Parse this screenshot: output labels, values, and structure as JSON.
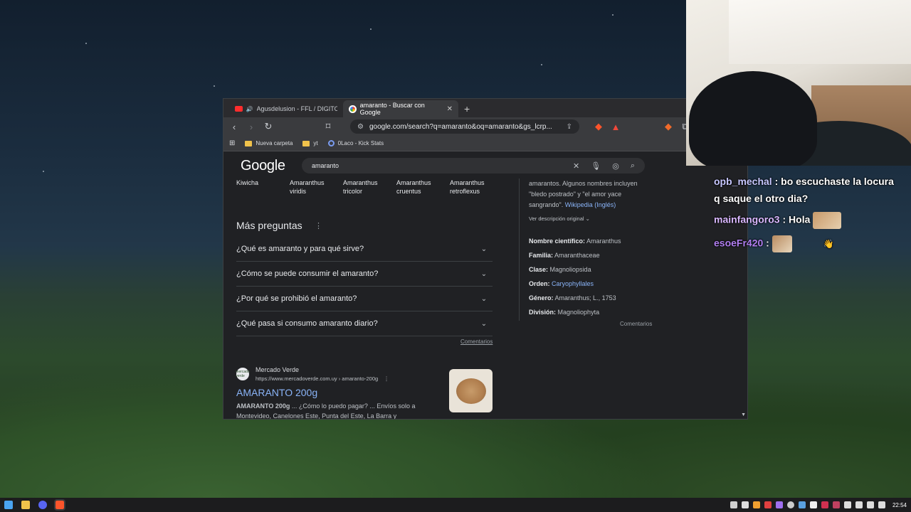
{
  "browser": {
    "tabs": [
      {
        "label": "Agusdelusion - FFL / DIGITOS | C",
        "active": false
      },
      {
        "label": "amaranto - Buscar con Google",
        "active": true
      }
    ],
    "url": "google.com/search?q=amaranto&oq=amaranto&gs_lcrp...",
    "bookmarks": [
      "Nueva carpeta",
      "yt",
      "0Laco - Kick Stats"
    ]
  },
  "google": {
    "logo": "Google",
    "query": "amaranto",
    "related": [
      "Kiwicha",
      "Amaranthus viridis",
      "Amaranthus tricolor",
      "Amaranthus cruentus",
      "Amaranthus retroflexus"
    ],
    "more_questions": {
      "title": "Más preguntas",
      "items": [
        "¿Qué es amaranto y para qué sirve?",
        "¿Cómo se puede consumir el amaranto?",
        "¿Por qué se prohibió el amaranto?",
        "¿Qué pasa si consumo amaranto diario?"
      ],
      "feedback": "Comentarios"
    },
    "result": {
      "favicon_text": "mercado verde",
      "site": "Mercado Verde",
      "url": "https://www.mercadoverde.com.uy › amaranto-200g",
      "title": "AMARANTO 200g",
      "snippet_bold": "AMARANTO 200g",
      "snippet": " ... ¿Cómo lo puedo pagar? ... Envíos solo a Montevideo, Canelones Este, Punta del Este, La Barra y"
    },
    "knowledge_panel": {
      "desc_line1": "amarantos. Algunos nombres incluyen",
      "desc_line2": "\"bledo postrado\" y \"el amor yace",
      "desc_line3": "sangrando\".",
      "wiki": "Wikipedia (Inglés)",
      "see_original": "Ver descripción original",
      "facts": [
        {
          "label": "Nombre científico:",
          "value": "Amaranthus"
        },
        {
          "label": "Familia:",
          "value": "Amaranthaceae"
        },
        {
          "label": "Clase:",
          "value": "Magnoliopsida"
        },
        {
          "label": "Orden:",
          "value": "Caryophyllales"
        },
        {
          "label": "Género:",
          "value": "Amaranthus; L., 1753"
        },
        {
          "label": "División:",
          "value": "Magnoliophyta"
        }
      ],
      "feedback": "Comentarios"
    }
  },
  "chat": [
    {
      "user": "opb_mechal",
      "text": "bo escuchaste la locura",
      "text2": "q saque el otro dia?"
    },
    {
      "user": "mainfangoro3",
      "text": "Hola"
    },
    {
      "user": "esoeFr420",
      "text": ""
    }
  ],
  "taskbar": {
    "clock": "22:54"
  }
}
